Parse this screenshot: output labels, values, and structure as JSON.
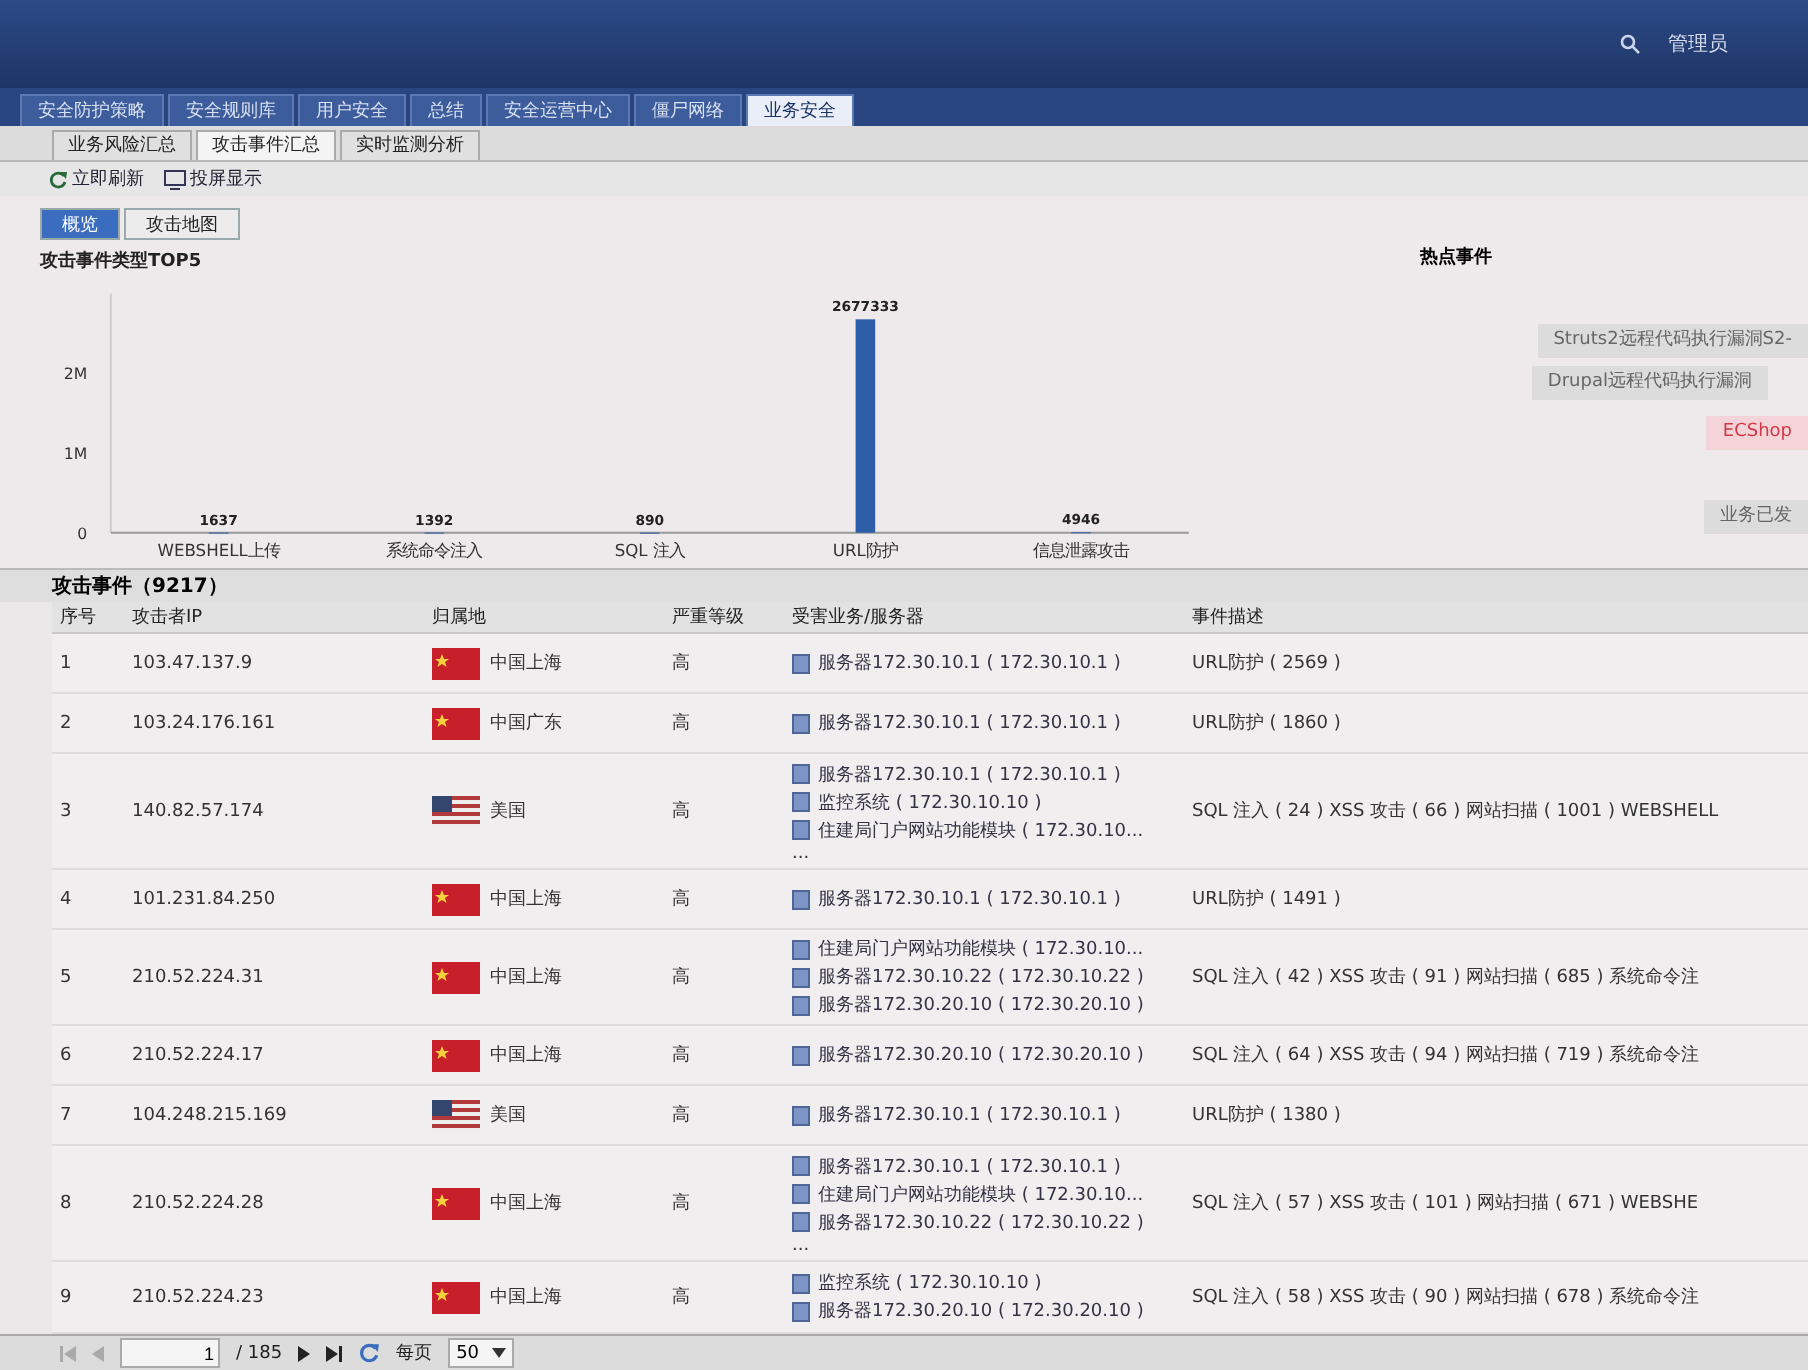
{
  "header": {
    "user": "管理员"
  },
  "tabs": [
    {
      "label": "安全防护策略",
      "selected": false
    },
    {
      "label": "安全规则库",
      "selected": false
    },
    {
      "label": "用户安全",
      "selected": false
    },
    {
      "label": "总结",
      "selected": false
    },
    {
      "label": "安全运营中心",
      "selected": false
    },
    {
      "label": "僵尸网络",
      "selected": false
    },
    {
      "label": "业务安全",
      "selected": true
    }
  ],
  "subtabs": [
    {
      "label": "业务风险汇总",
      "selected": false
    },
    {
      "label": "攻击事件汇总",
      "selected": true
    },
    {
      "label": "实时监测分析",
      "selected": false
    }
  ],
  "toolbar": [
    {
      "label": "立即刷新",
      "kind": "refresh"
    },
    {
      "label": "投屏显示",
      "kind": "screen"
    }
  ],
  "view_switch": [
    {
      "label": "概览",
      "selected": true
    },
    {
      "label": "攻击地图",
      "selected": false
    }
  ],
  "chart": {
    "chart_data": {
      "type": "bar",
      "title": "攻击事件类型TOP5",
      "categories": [
        "WEBSHELL上传",
        "系统命令注入",
        "SQL 注入",
        "URL防护",
        "信息泄露攻击"
      ],
      "series": [
        {
          "color": "#2f5ea8",
          "values": [
            1637,
            1392,
            890,
            2677333,
            4946
          ]
        }
      ],
      "ylim": [
        0,
        3000000
      ],
      "yticks": [
        0,
        {
          "value": 1000000,
          "label": "1M"
        },
        {
          "value": 2000000,
          "label": "2M"
        }
      ],
      "data_labels": true
    }
  },
  "hot_events": {
    "title": "热点事件",
    "items": [
      {
        "label": "Struts2远程代码执行漏洞S2-",
        "highlighted": false
      },
      {
        "label": "Drupal远程代码执行漏洞",
        "highlighted": false
      },
      {
        "label": "ECShop",
        "highlighted": true
      },
      {
        "label": "业务已发",
        "highlighted": false
      }
    ]
  },
  "table": {
    "title": "攻击事件（9217）",
    "columns": [
      "序号",
      "攻击者IP",
      "归属地",
      "严重等级",
      "受害业务/服务器",
      "事件描述"
    ],
    "rows": [
      {
        "index": "1",
        "ip": "103.47.137.9",
        "kind": "china",
        "location": "中国上海",
        "severity": "高",
        "servers": [
          "服务器172.30.10.1 ( 172.30.10.1 )"
        ],
        "description": "URL防护 ( 2569 )"
      },
      {
        "index": "2",
        "ip": "103.24.176.161",
        "kind": "china",
        "location": "中国广东",
        "severity": "高",
        "servers": [
          "服务器172.30.10.1 ( 172.30.10.1 )"
        ],
        "description": "URL防护 ( 1860 )"
      },
      {
        "index": "3",
        "ip": "140.82.57.174",
        "kind": "usa",
        "location": "美国",
        "severity": "高",
        "servers": [
          "服务器172.30.10.1 ( 172.30.10.1 )",
          "监控系统 ( 172.30.10.10 )",
          "住建局门户网站功能模块 ( 172.30.10..."
        ],
        "more": "...",
        "description": "SQL 注入 ( 24 ) XSS 攻击 ( 66 ) 网站扫描 ( 1001 ) WEBSHELL"
      },
      {
        "index": "4",
        "ip": "101.231.84.250",
        "kind": "china",
        "location": "中国上海",
        "severity": "高",
        "servers": [
          "服务器172.30.10.1 ( 172.30.10.1 )"
        ],
        "description": "URL防护 ( 1491 )"
      },
      {
        "index": "5",
        "ip": "210.52.224.31",
        "kind": "china",
        "location": "中国上海",
        "severity": "高",
        "servers": [
          "住建局门户网站功能模块 ( 172.30.10...",
          "服务器172.30.10.22 ( 172.30.10.22 )",
          "服务器172.30.20.10 ( 172.30.20.10 )"
        ],
        "description": "SQL 注入 ( 42 ) XSS 攻击 ( 91 ) 网站扫描 ( 685 ) 系统命令注"
      },
      {
        "index": "6",
        "ip": "210.52.224.17",
        "kind": "china",
        "location": "中国上海",
        "severity": "高",
        "servers": [
          "服务器172.30.20.10 ( 172.30.20.10 )"
        ],
        "description": "SQL 注入 ( 64 ) XSS 攻击 ( 94 ) 网站扫描 ( 719 ) 系统命令注"
      },
      {
        "index": "7",
        "ip": "104.248.215.169",
        "kind": "usa",
        "location": "美国",
        "severity": "高",
        "servers": [
          "服务器172.30.10.1 ( 172.30.10.1 )"
        ],
        "description": "URL防护 ( 1380 )"
      },
      {
        "index": "8",
        "ip": "210.52.224.28",
        "kind": "china",
        "location": "中国上海",
        "severity": "高",
        "servers": [
          "服务器172.30.10.1 ( 172.30.10.1 )",
          "住建局门户网站功能模块 ( 172.30.10...",
          "服务器172.30.10.22 ( 172.30.10.22 )"
        ],
        "more": "...",
        "description": "SQL 注入 ( 57 ) XSS 攻击 ( 101 ) 网站扫描 ( 671 ) WEBSHE"
      },
      {
        "index": "9",
        "ip": "210.52.224.23",
        "kind": "china",
        "location": "中国上海",
        "severity": "高",
        "servers": [
          "监控系统 ( 172.30.10.10 )",
          "服务器172.30.20.10 ( 172.30.20.10 )"
        ],
        "description": "SQL 注入 ( 58 ) XSS 攻击 ( 90 ) 网站扫描 ( 678 ) 系统命令注"
      }
    ]
  },
  "pager": {
    "page": "1",
    "total": "/ 185",
    "per_page_label": "每页",
    "per_page": "50"
  }
}
